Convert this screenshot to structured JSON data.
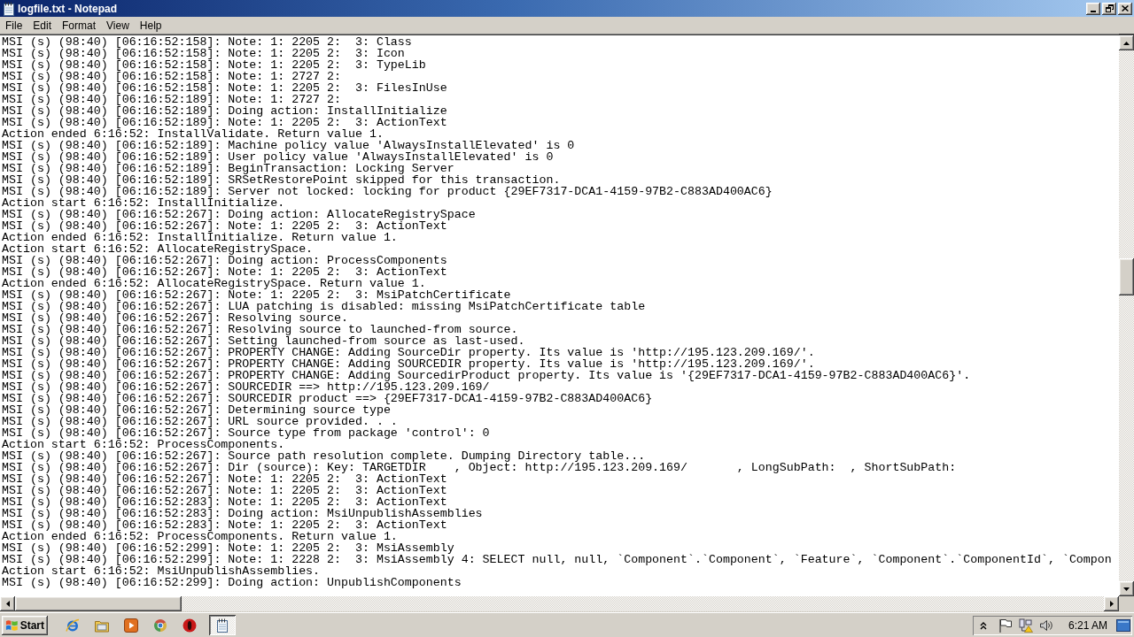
{
  "window": {
    "title": "logfile.txt - Notepad"
  },
  "menu": [
    "File",
    "Edit",
    "Format",
    "View",
    "Help"
  ],
  "editor": {
    "lines": [
      "MSI (s) (98:40) [06:16:52:158]: Note: 1: 2205 2:  3: Class",
      "MSI (s) (98:40) [06:16:52:158]: Note: 1: 2205 2:  3: Icon",
      "MSI (s) (98:40) [06:16:52:158]: Note: 1: 2205 2:  3: TypeLib",
      "MSI (s) (98:40) [06:16:52:158]: Note: 1: 2727 2:",
      "MSI (s) (98:40) [06:16:52:158]: Note: 1: 2205 2:  3: FilesInUse",
      "MSI (s) (98:40) [06:16:52:189]: Note: 1: 2727 2:",
      "MSI (s) (98:40) [06:16:52:189]: Doing action: InstallInitialize",
      "MSI (s) (98:40) [06:16:52:189]: Note: 1: 2205 2:  3: ActionText",
      "Action ended 6:16:52: InstallValidate. Return value 1.",
      "MSI (s) (98:40) [06:16:52:189]: Machine policy value 'AlwaysInstallElevated' is 0",
      "MSI (s) (98:40) [06:16:52:189]: User policy value 'AlwaysInstallElevated' is 0",
      "MSI (s) (98:40) [06:16:52:189]: BeginTransaction: Locking Server",
      "MSI (s) (98:40) [06:16:52:189]: SRSetRestorePoint skipped for this transaction.",
      "MSI (s) (98:40) [06:16:52:189]: Server not locked: locking for product {29EF7317-DCA1-4159-97B2-C883AD400AC6}",
      "Action start 6:16:52: InstallInitialize.",
      "MSI (s) (98:40) [06:16:52:267]: Doing action: AllocateRegistrySpace",
      "MSI (s) (98:40) [06:16:52:267]: Note: 1: 2205 2:  3: ActionText",
      "Action ended 6:16:52: InstallInitialize. Return value 1.",
      "Action start 6:16:52: AllocateRegistrySpace.",
      "MSI (s) (98:40) [06:16:52:267]: Doing action: ProcessComponents",
      "MSI (s) (98:40) [06:16:52:267]: Note: 1: 2205 2:  3: ActionText",
      "Action ended 6:16:52: AllocateRegistrySpace. Return value 1.",
      "MSI (s) (98:40) [06:16:52:267]: Note: 1: 2205 2:  3: MsiPatchCertificate",
      "MSI (s) (98:40) [06:16:52:267]: LUA patching is disabled: missing MsiPatchCertificate table",
      "MSI (s) (98:40) [06:16:52:267]: Resolving source.",
      "MSI (s) (98:40) [06:16:52:267]: Resolving source to launched-from source.",
      "MSI (s) (98:40) [06:16:52:267]: Setting launched-from source as last-used.",
      "MSI (s) (98:40) [06:16:52:267]: PROPERTY CHANGE: Adding SourceDir property. Its value is 'http://195.123.209.169/'.",
      "MSI (s) (98:40) [06:16:52:267]: PROPERTY CHANGE: Adding SOURCEDIR property. Its value is 'http://195.123.209.169/'.",
      "MSI (s) (98:40) [06:16:52:267]: PROPERTY CHANGE: Adding SourcedirProduct property. Its value is '{29EF7317-DCA1-4159-97B2-C883AD400AC6}'.",
      "MSI (s) (98:40) [06:16:52:267]: SOURCEDIR ==> http://195.123.209.169/",
      "MSI (s) (98:40) [06:16:52:267]: SOURCEDIR product ==> {29EF7317-DCA1-4159-97B2-C883AD400AC6}",
      "MSI (s) (98:40) [06:16:52:267]: Determining source type",
      "MSI (s) (98:40) [06:16:52:267]: URL source provided. . .",
      "MSI (s) (98:40) [06:16:52:267]: Source type from package 'control': 0",
      "Action start 6:16:52: ProcessComponents.",
      "MSI (s) (98:40) [06:16:52:267]: Source path resolution complete. Dumping Directory table...",
      "MSI (s) (98:40) [06:16:52:267]: Dir (source): Key: TARGETDIR    , Object: http://195.123.209.169/       , LongSubPath:  , ShortSubPath:",
      "MSI (s) (98:40) [06:16:52:267]: Note: 1: 2205 2:  3: ActionText",
      "MSI (s) (98:40) [06:16:52:267]: Note: 1: 2205 2:  3: ActionText",
      "MSI (s) (98:40) [06:16:52:283]: Note: 1: 2205 2:  3: ActionText",
      "MSI (s) (98:40) [06:16:52:283]: Doing action: MsiUnpublishAssemblies",
      "MSI (s) (98:40) [06:16:52:283]: Note: 1: 2205 2:  3: ActionText",
      "Action ended 6:16:52: ProcessComponents. Return value 1.",
      "MSI (s) (98:40) [06:16:52:299]: Note: 1: 2205 2:  3: MsiAssembly",
      "MSI (s) (98:40) [06:16:52:299]: Note: 1: 2228 2:  3: MsiAssembly 4: SELECT null, null, `Component`.`Component`, `Feature`, `Component`.`ComponentId`, `Compon",
      "Action start 6:16:52: MsiUnpublishAssemblies.",
      "MSI (s) (98:40) [06:16:52:299]: Doing action: UnpublishComponents"
    ]
  },
  "taskbar": {
    "start": "Start",
    "tasks": [
      {
        "selected": true
      }
    ],
    "clock": "6:21 AM"
  }
}
